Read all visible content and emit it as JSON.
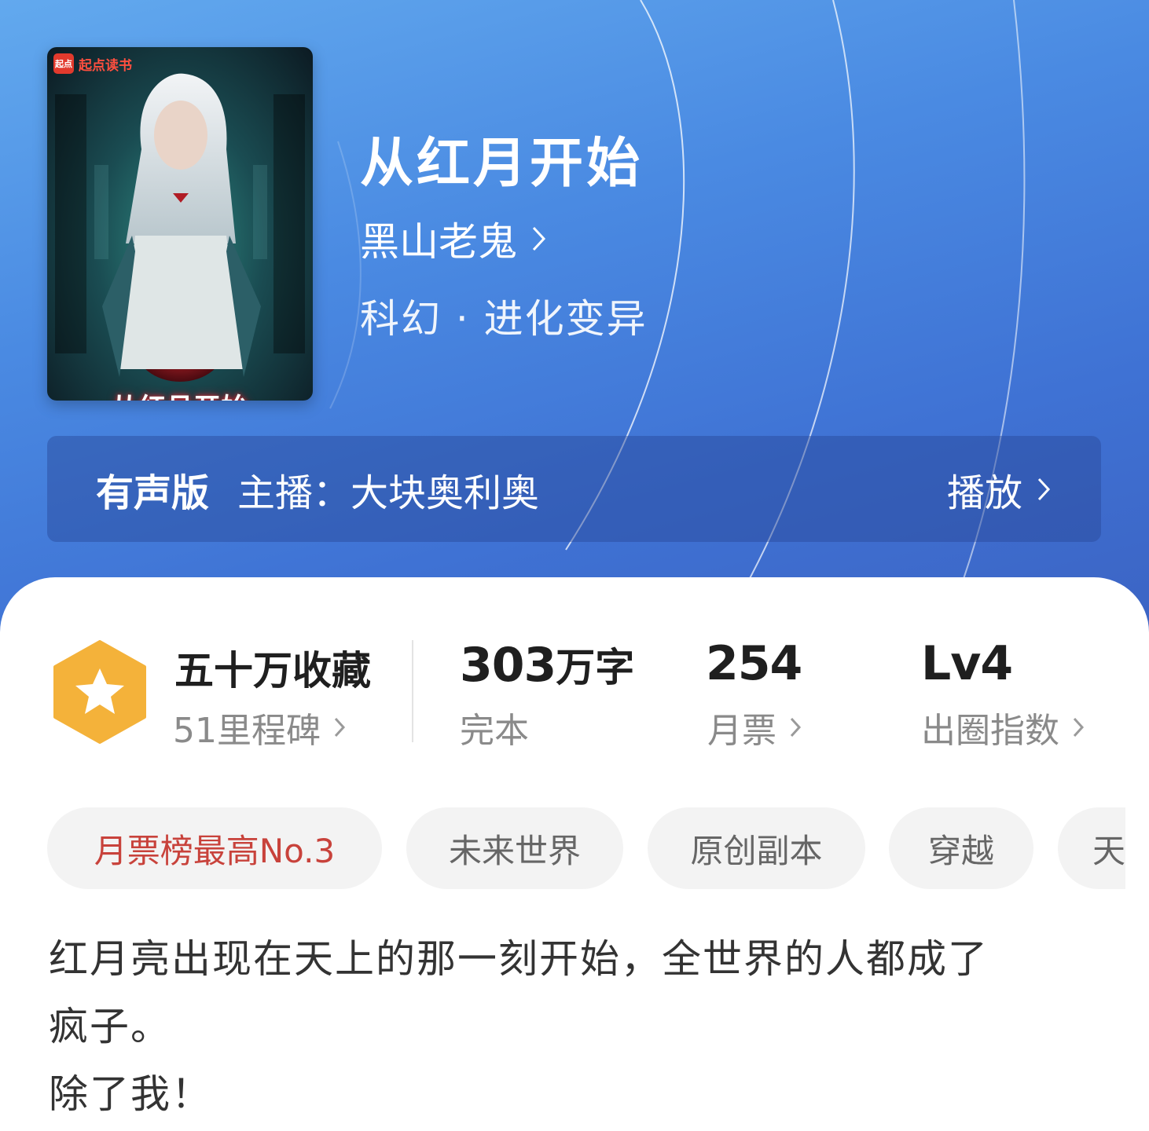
{
  "book": {
    "title": "从红月开始",
    "author": "黑山老鬼",
    "genre": "科幻 · 进化变异",
    "cover": {
      "publisher_mark": "起点",
      "publisher": "起点读书",
      "title_art": "从红月开始"
    }
  },
  "audio": {
    "label": "有声版",
    "host": "主播：大块奥利奥",
    "play": "播放"
  },
  "stats": {
    "collection": {
      "value": "五十万收藏",
      "sub": "51里程碑"
    },
    "words": {
      "number": "303",
      "unit": "万字",
      "sub": "完本"
    },
    "tickets": {
      "value": "254",
      "sub": "月票"
    },
    "level": {
      "value": "Lv4",
      "sub": "出圈指数"
    }
  },
  "tags": [
    "月票榜最高No.3",
    "未来世界",
    "原创副本",
    "穿越",
    "天"
  ],
  "description": [
    "红月亮出现在天上的那一刻开始，全世界的人都成了",
    "疯子。",
    "除了我！"
  ],
  "colors": {
    "hero_top": "#62a9ee",
    "hero_bottom": "#3c64c4",
    "badge": "#f4b23a",
    "rank_tag_text": "#c8423b"
  },
  "icons": [
    "chevron-right-icon",
    "star-badge-icon",
    "qidian-logo-icon"
  ]
}
